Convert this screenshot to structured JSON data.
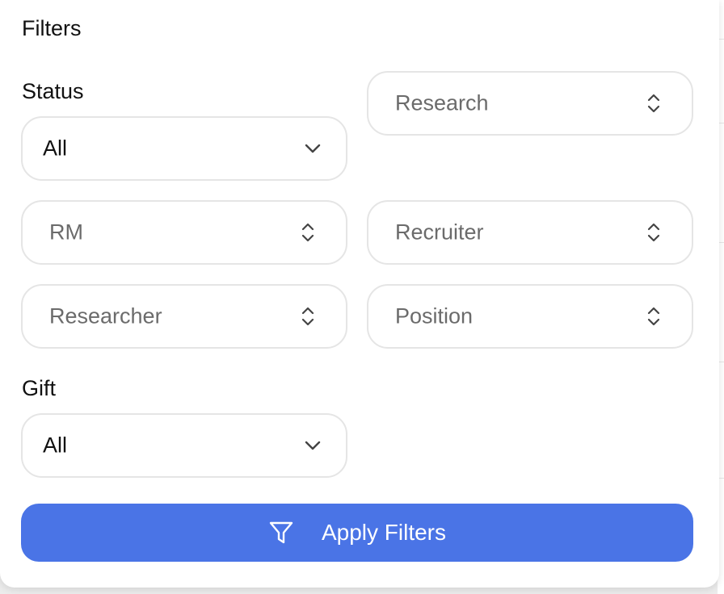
{
  "panel": {
    "title": "Filters"
  },
  "status": {
    "label": "Status",
    "value": "All"
  },
  "research": {
    "placeholder": "Research"
  },
  "rm": {
    "placeholder": "RM"
  },
  "recruiter": {
    "placeholder": "Recruiter"
  },
  "researcher": {
    "placeholder": "Researcher"
  },
  "position": {
    "placeholder": "Position"
  },
  "gift": {
    "label": "Gift",
    "value": "All"
  },
  "apply_button": {
    "label": "Apply Filters",
    "icon": "filter-icon",
    "color": "#4a74e6"
  },
  "icons": {
    "select": "chevron-down-icon",
    "combobox": "chevrons-up-down-icon"
  }
}
